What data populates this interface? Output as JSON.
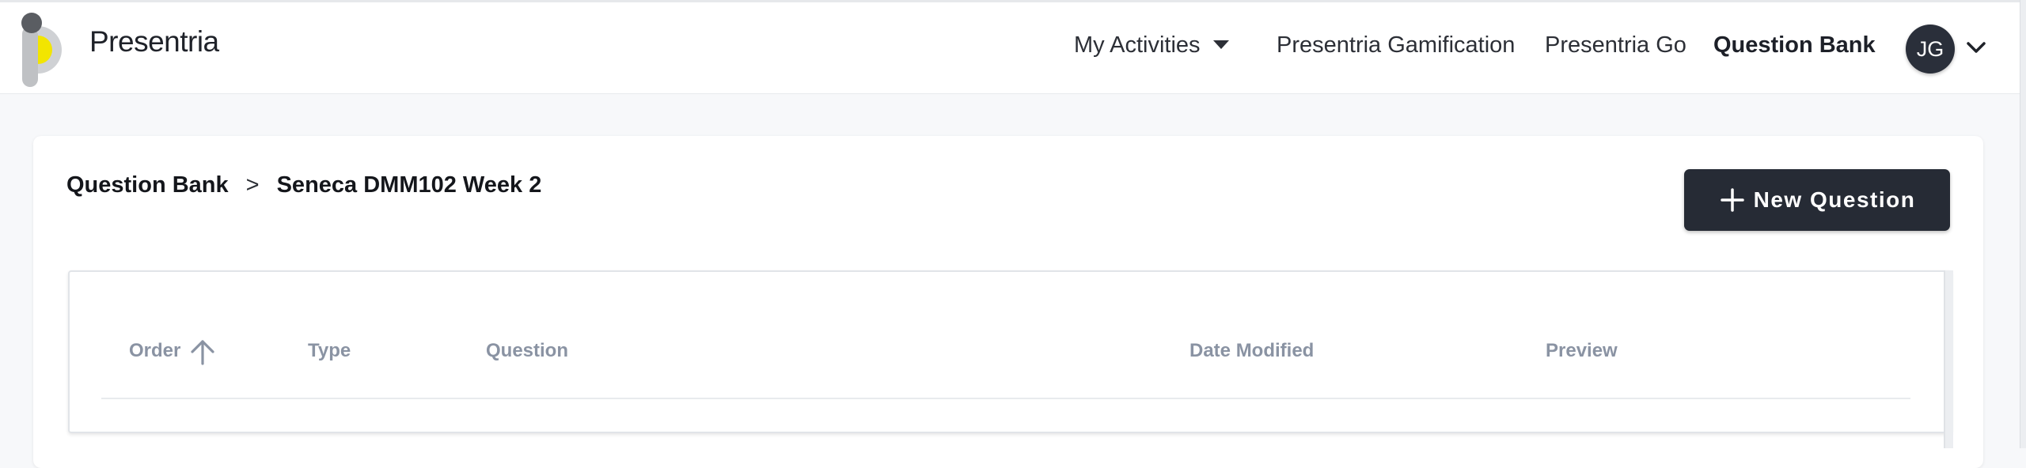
{
  "app": {
    "brand": "Presentria"
  },
  "nav": {
    "my_activities": "My Activities",
    "gamification": "Presentria Gamification",
    "go": "Presentria Go",
    "question_bank": "Question Bank",
    "user_initials": "JG"
  },
  "breadcrumb": {
    "root": "Question Bank",
    "separator": ">",
    "current": "Seneca DMM102 Week 2"
  },
  "actions": {
    "new_question": "New Question"
  },
  "table": {
    "columns": [
      "Order",
      "Type",
      "Question",
      "Date Modified",
      "Preview"
    ],
    "sort_column": "Order",
    "sort_direction": "ascending"
  },
  "colors": {
    "primary_dark": "#262b35",
    "header_text": "#8a93a3",
    "logo_accent": "#f2e500"
  }
}
